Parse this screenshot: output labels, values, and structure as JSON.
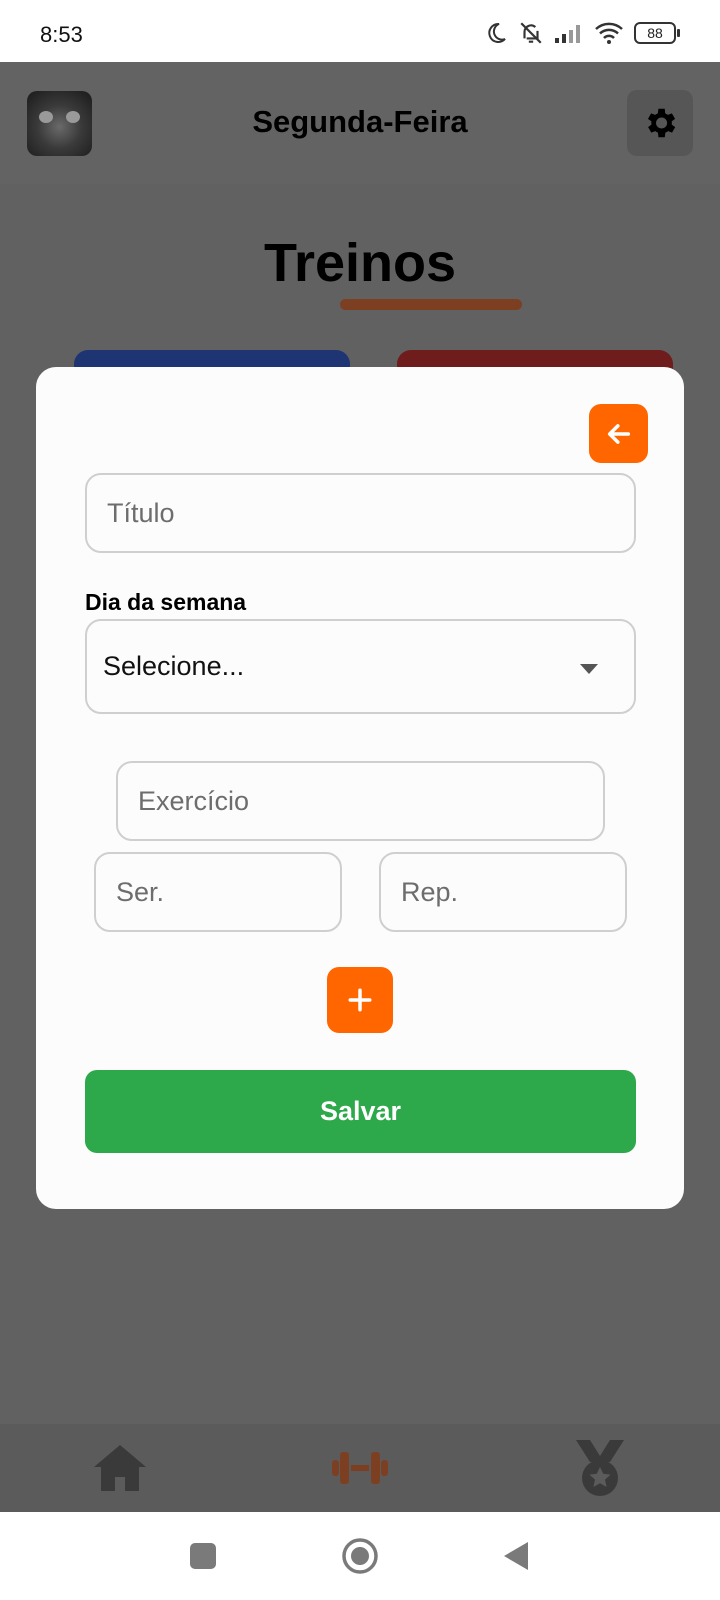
{
  "status_bar": {
    "time": "8:53",
    "battery": "88",
    "icons": [
      "moon-icon",
      "bell-off-icon",
      "signal-icon",
      "wifi-icon",
      "battery-icon"
    ]
  },
  "header": {
    "title": "Segunda-Feira",
    "settings_icon": "gear-icon"
  },
  "screen": {
    "title": "Treinos"
  },
  "modal": {
    "back_icon": "arrow-left-icon",
    "title_placeholder": "Título",
    "day_label": "Dia da semana",
    "day_select_value": "Selecione...",
    "exercise_placeholder": "Exercício",
    "series_placeholder": "Ser.",
    "reps_placeholder": "Rep.",
    "add_icon": "plus-icon",
    "save_label": "Salvar"
  },
  "tab_bar": {
    "items": [
      {
        "icon": "home-icon",
        "active": false
      },
      {
        "icon": "dumbbell-icon",
        "active": true
      },
      {
        "icon": "medal-icon",
        "active": false
      }
    ]
  },
  "colors": {
    "accent_orange": "#ff6600",
    "save_green": "#2da84a",
    "active_tab": "#7d3f21",
    "overlay": "#616161"
  }
}
